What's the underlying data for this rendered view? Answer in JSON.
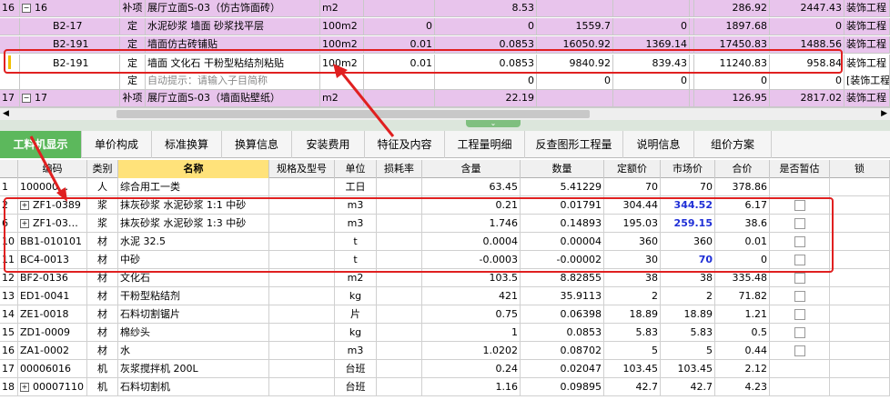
{
  "top_rows": [
    {
      "idx": "16",
      "expand": "−",
      "code": "16",
      "type": "补项",
      "name": "展厅立面S-03（仿古饰面砖）",
      "unit": "m2",
      "q": "",
      "qty": "8.53",
      "p1": "",
      "p2": "",
      "p3": "",
      "v1": "286.92",
      "v2": "2447.43",
      "spec": "装饰工程"
    },
    {
      "idx": "",
      "expand": "",
      "code": "B2-17",
      "type": "定",
      "name": "水泥砂浆 墙面 砂浆找平层",
      "unit": "100m2",
      "q": "0",
      "qty": "0",
      "p1": "1559.7",
      "p2": "0",
      "p3": "",
      "v1": "1897.68",
      "v2": "0",
      "spec": "装饰工程"
    },
    {
      "idx": "",
      "expand": "",
      "code": "B2-191",
      "type": "定",
      "name": "墙面仿古砖铺贴",
      "unit": "100m2",
      "q": "0.01",
      "qty": "0.0853",
      "p1": "16050.92",
      "p2": "1369.14",
      "p3": "",
      "v1": "17450.83",
      "v2": "1488.56",
      "spec": "装饰工程"
    },
    {
      "idx": "",
      "expand": "",
      "code": "B2-191",
      "type": "定",
      "name": "墙面 文化石 干粉型粘结剂粘贴",
      "unit": "100m2",
      "q": "0.01",
      "qty": "0.0853",
      "p1": "9840.92",
      "p2": "839.43",
      "p3": "",
      "v1": "11240.83",
      "v2": "958.84",
      "spec": "装饰工程"
    },
    {
      "idx": "",
      "expand": "",
      "code": "",
      "type": "定",
      "name": "自动提示：请输入子目简称",
      "unit": "",
      "q": "",
      "qty": "0",
      "p1": "0",
      "p2": "0",
      "p3": "",
      "v1": "0",
      "v2": "0",
      "spec": "[装饰工程"
    },
    {
      "idx": "17",
      "expand": "−",
      "code": "17",
      "type": "补项",
      "name": "展厅立面S-03（墙面贴壁纸）",
      "unit": "m2",
      "q": "",
      "qty": "22.19",
      "p1": "",
      "p2": "",
      "p3": "",
      "v1": "126.95",
      "v2": "2817.02",
      "spec": "装饰工程"
    }
  ],
  "tabs": [
    "工料机显示",
    "单价构成",
    "标准换算",
    "换算信息",
    "安装费用",
    "特征及内容",
    "工程量明细",
    "反查图形工程量",
    "说明信息",
    "组价方案"
  ],
  "columns": [
    "编码",
    "类别",
    "名称",
    "规格及型号",
    "单位",
    "损耗率",
    "含量",
    "数量",
    "定额价",
    "市场价",
    "合价",
    "是否暂估",
    "锁"
  ],
  "rows": [
    {
      "idx": "1",
      "plus": false,
      "code": "100000…",
      "type": "人",
      "name": "综合用工一类",
      "spec": "",
      "unit": "工日",
      "loss": "",
      "content": "63.45",
      "qty": "5.41229",
      "quota": "70",
      "market": "70",
      "total": "378.86",
      "blue": false,
      "check": false
    },
    {
      "idx": "2",
      "plus": true,
      "code": "ZF1-0389",
      "type": "浆",
      "name": "抹灰砂浆 水泥砂浆 1:1 中砂",
      "spec": "",
      "unit": "m3",
      "loss": "",
      "content": "0.21",
      "qty": "0.01791",
      "quota": "304.44",
      "market": "344.52",
      "total": "6.17",
      "blue": true,
      "check": true
    },
    {
      "idx": "6",
      "plus": true,
      "code": "ZF1-03…",
      "type": "浆",
      "name": "抹灰砂浆 水泥砂浆 1:3 中砂",
      "spec": "",
      "unit": "m3",
      "loss": "",
      "content": "1.746",
      "qty": "0.14893",
      "quota": "195.03",
      "market": "259.15",
      "total": "38.6",
      "blue": true,
      "check": true
    },
    {
      "idx": "10",
      "plus": false,
      "code": "BB1-010101",
      "type": "材",
      "name": "水泥 32.5",
      "spec": "",
      "unit": "t",
      "loss": "",
      "content": "0.0004",
      "qty": "0.00004",
      "quota": "360",
      "market": "360",
      "total": "0.01",
      "blue": false,
      "check": true
    },
    {
      "idx": "11",
      "plus": false,
      "code": "BC4-0013",
      "type": "材",
      "name": "中砂",
      "spec": "",
      "unit": "t",
      "loss": "",
      "content": "-0.0003",
      "qty": "-0.00002",
      "quota": "30",
      "market": "70",
      "total": "0",
      "blue": true,
      "check": true
    },
    {
      "idx": "12",
      "plus": false,
      "code": "BF2-0136",
      "type": "材",
      "name": "文化石",
      "spec": "",
      "unit": "m2",
      "loss": "",
      "content": "103.5",
      "qty": "8.82855",
      "quota": "38",
      "market": "38",
      "total": "335.48",
      "blue": false,
      "check": true
    },
    {
      "idx": "13",
      "plus": false,
      "code": "ED1-0041",
      "type": "材",
      "name": "干粉型粘结剂",
      "spec": "",
      "unit": "kg",
      "loss": "",
      "content": "421",
      "qty": "35.9113",
      "quota": "2",
      "market": "2",
      "total": "71.82",
      "blue": false,
      "check": true
    },
    {
      "idx": "14",
      "plus": false,
      "code": "ZE1-0018",
      "type": "材",
      "name": "石料切割锯片",
      "spec": "",
      "unit": "片",
      "loss": "",
      "content": "0.75",
      "qty": "0.06398",
      "quota": "18.89",
      "market": "18.89",
      "total": "1.21",
      "blue": false,
      "check": true
    },
    {
      "idx": "15",
      "plus": false,
      "code": "ZD1-0009",
      "type": "材",
      "name": "棉纱头",
      "spec": "",
      "unit": "kg",
      "loss": "",
      "content": "1",
      "qty": "0.0853",
      "quota": "5.83",
      "market": "5.83",
      "total": "0.5",
      "blue": false,
      "check": true
    },
    {
      "idx": "16",
      "plus": false,
      "code": "ZA1-0002",
      "type": "材",
      "name": "水",
      "spec": "",
      "unit": "m3",
      "loss": "",
      "content": "1.0202",
      "qty": "0.08702",
      "quota": "5",
      "market": "5",
      "total": "0.44",
      "blue": false,
      "check": true
    },
    {
      "idx": "17",
      "plus": false,
      "code": "00006016",
      "type": "机",
      "name": "灰浆搅拌机 200L",
      "spec": "",
      "unit": "台班",
      "loss": "",
      "content": "0.24",
      "qty": "0.02047",
      "quota": "103.45",
      "market": "103.45",
      "total": "2.12",
      "blue": false,
      "check": false
    },
    {
      "idx": "18",
      "plus": true,
      "code": "00007110",
      "type": "机",
      "name": "石料切割机",
      "spec": "",
      "unit": "台班",
      "loss": "",
      "content": "1.16",
      "qty": "0.09895",
      "quota": "42.7",
      "market": "42.7",
      "total": "4.23",
      "blue": false,
      "check": false
    }
  ],
  "colors": {
    "purple_row": "#e8c4ec",
    "active_tab": "#5cb85c",
    "highlight_header": "#ffe27a",
    "annotation_red": "#e02020",
    "blue_value": "#1f2fd6"
  }
}
